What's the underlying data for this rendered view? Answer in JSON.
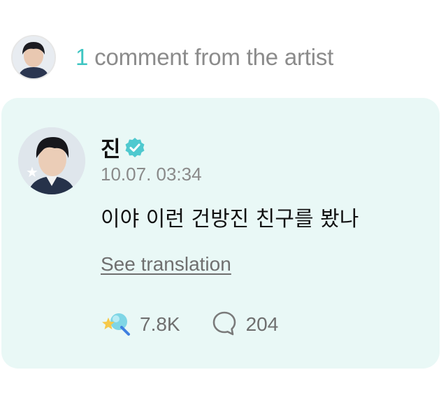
{
  "header": {
    "count": "1",
    "label": "comment from the artist"
  },
  "comment": {
    "author": "진",
    "verified_icon": "verified-check-icon",
    "timestamp": "10.07. 03:34",
    "text": "이야 이런 건방진 친구를 봤나",
    "translate_label": "See translation",
    "reactions_count": "7.8K",
    "reactions_icon": "sparkle-reaction-icon",
    "replies_count": "204",
    "replies_icon": "comment-bubble-icon"
  },
  "colors": {
    "accent": "#3ec5c2",
    "card_background": "#e9f8f6",
    "muted_text": "#8b8b8b"
  }
}
